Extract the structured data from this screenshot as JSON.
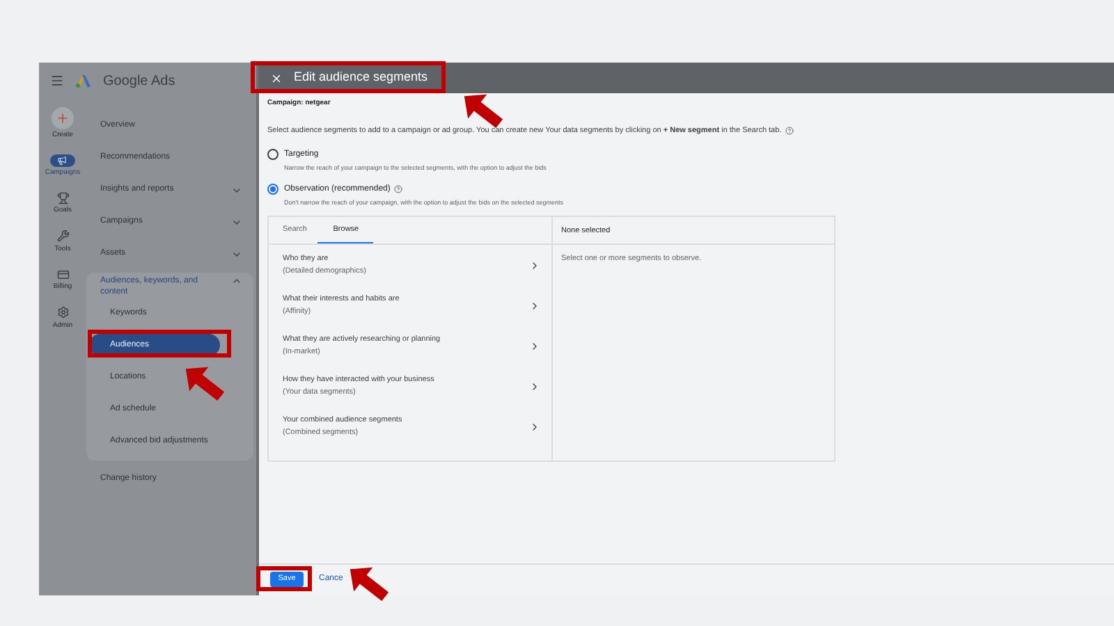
{
  "app": {
    "name": "Google Ads"
  },
  "rail": [
    {
      "label": "Create",
      "selected": false
    },
    {
      "label": "Campaigns",
      "selected": true
    },
    {
      "label": "Goals",
      "selected": false
    },
    {
      "label": "Tools",
      "selected": false
    },
    {
      "label": "Billing",
      "selected": false
    },
    {
      "label": "Admin",
      "selected": false
    }
  ],
  "nav": [
    {
      "label": "Overview"
    },
    {
      "label": "Recommendations"
    },
    {
      "label": "Insights and reports",
      "expanded": false
    },
    {
      "label": "Campaigns",
      "expanded": false
    },
    {
      "label": "Assets",
      "expanded": false
    },
    {
      "label": "Audiences, keywords, and content",
      "expanded": true,
      "children": [
        {
          "label": "Keywords",
          "selected": false
        },
        {
          "label": "Audiences",
          "selected": true
        },
        {
          "label": "Locations",
          "selected": false
        },
        {
          "label": "Ad schedule",
          "selected": false
        },
        {
          "label": "Advanced bid adjustments",
          "selected": false
        }
      ]
    },
    {
      "label": "Change history"
    }
  ],
  "dialog": {
    "title": "Edit audience segments",
    "campaign": "Campaign: netgear",
    "description": "Select audience segments to add to a campaign or ad group. You can create new Your data segments by clicking on **+ New segment** in the Search tab.",
    "options": [
      {
        "label": "Targeting",
        "description": "Narrow the reach of your campaign to the selected segments, with the option to adjust the bids",
        "selected": false,
        "help": false
      },
      {
        "label": "Observation (recommended)",
        "description": "Don't narrow the reach of your campaign, with the option to adjust the bids on the selected segments",
        "selected": true,
        "help": true
      }
    ],
    "tabs": [
      {
        "label": "Search",
        "selected": false
      },
      {
        "label": "Browse",
        "selected": true
      }
    ],
    "categories": [
      {
        "title": "Who they are",
        "subtitle": "(Detailed demographics)"
      },
      {
        "title": "What their interests and habits are",
        "subtitle": "(Affinity)"
      },
      {
        "title": "What they are actively researching or planning",
        "subtitle": "(In-market)"
      },
      {
        "title": "How they have interacted with your business",
        "subtitle": "(Your data segments)"
      },
      {
        "title": "Your combined audience segments",
        "subtitle": "(Combined segments)"
      }
    ],
    "selection_title": "None selected",
    "selection_empty": "Select one or more segments to observe.",
    "buttons": [
      {
        "label": "Save",
        "kind": "primary"
      },
      {
        "label": "Cance",
        "kind": "text"
      }
    ]
  }
}
